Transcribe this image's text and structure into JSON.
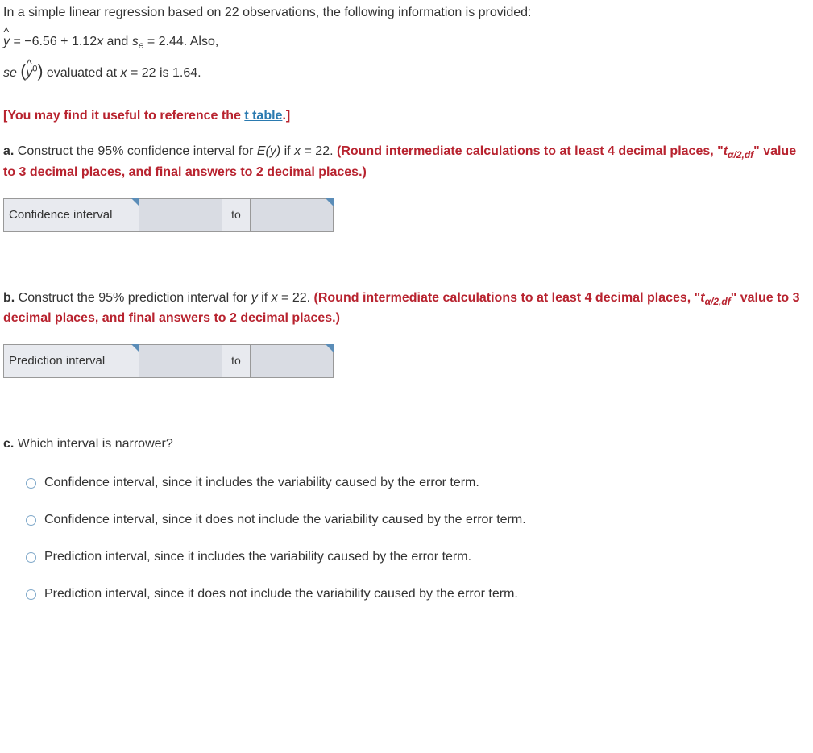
{
  "intro": "In a simple linear regression based on 22 observations, the following information is provided:",
  "eq_part1": " = −6.56 + 1.12",
  "eq_x": "x",
  "eq_and": " and ",
  "eq_se": "s",
  "eq_se_sub": "e",
  "eq_se_val": " = 2.44. Also,",
  "eq2_pre": "se ",
  "eq2_post": " evaluated at ",
  "eq2_x": "x",
  "eq2_val": " = 22 is 1.64.",
  "ref_pre": "[You may find it useful to reference the ",
  "ref_link": "t table",
  "ref_post": ".]",
  "a_label": "a.",
  "a_text1": " Construct the 95% confidence interval for ",
  "a_ey": "E",
  "a_ey2": "(y)",
  "a_text2": " if ",
  "a_x": "x",
  "a_text3": " = 22. ",
  "a_bold1": "(Round intermediate calculations to at least 4 decimal places, \"",
  "a_t": "t",
  "a_alpha": "α/2,df",
  "a_bold2": "\" value to 3 decimal places, and final answers to 2 decimal places.)",
  "ci_label": "Confidence interval",
  "to": "to",
  "b_label": "b.",
  "b_text1": " Construct the 95% prediction interval for ",
  "b_y": "y",
  "b_text2": " if ",
  "b_x": "x",
  "b_text3": " = 22. ",
  "b_bold1": "(Round intermediate calculations to at least 4 decimal places, \"",
  "b_t": "t",
  "b_alpha": "α/2,df",
  "b_bold2": "\" value to 3 decimal places, and final answers to 2 decimal places.)",
  "pi_label": "Prediction interval",
  "c_label": "c.",
  "c_text": " Which interval is narrower?",
  "opt1": "Confidence interval, since it includes the variability caused by the error term.",
  "opt2": "Confidence interval, since it does not include the variability caused by the error term.",
  "opt3": "Prediction interval, since it includes the variability caused by the error term.",
  "opt4": "Prediction interval, since it does not include the variability caused by the error term."
}
